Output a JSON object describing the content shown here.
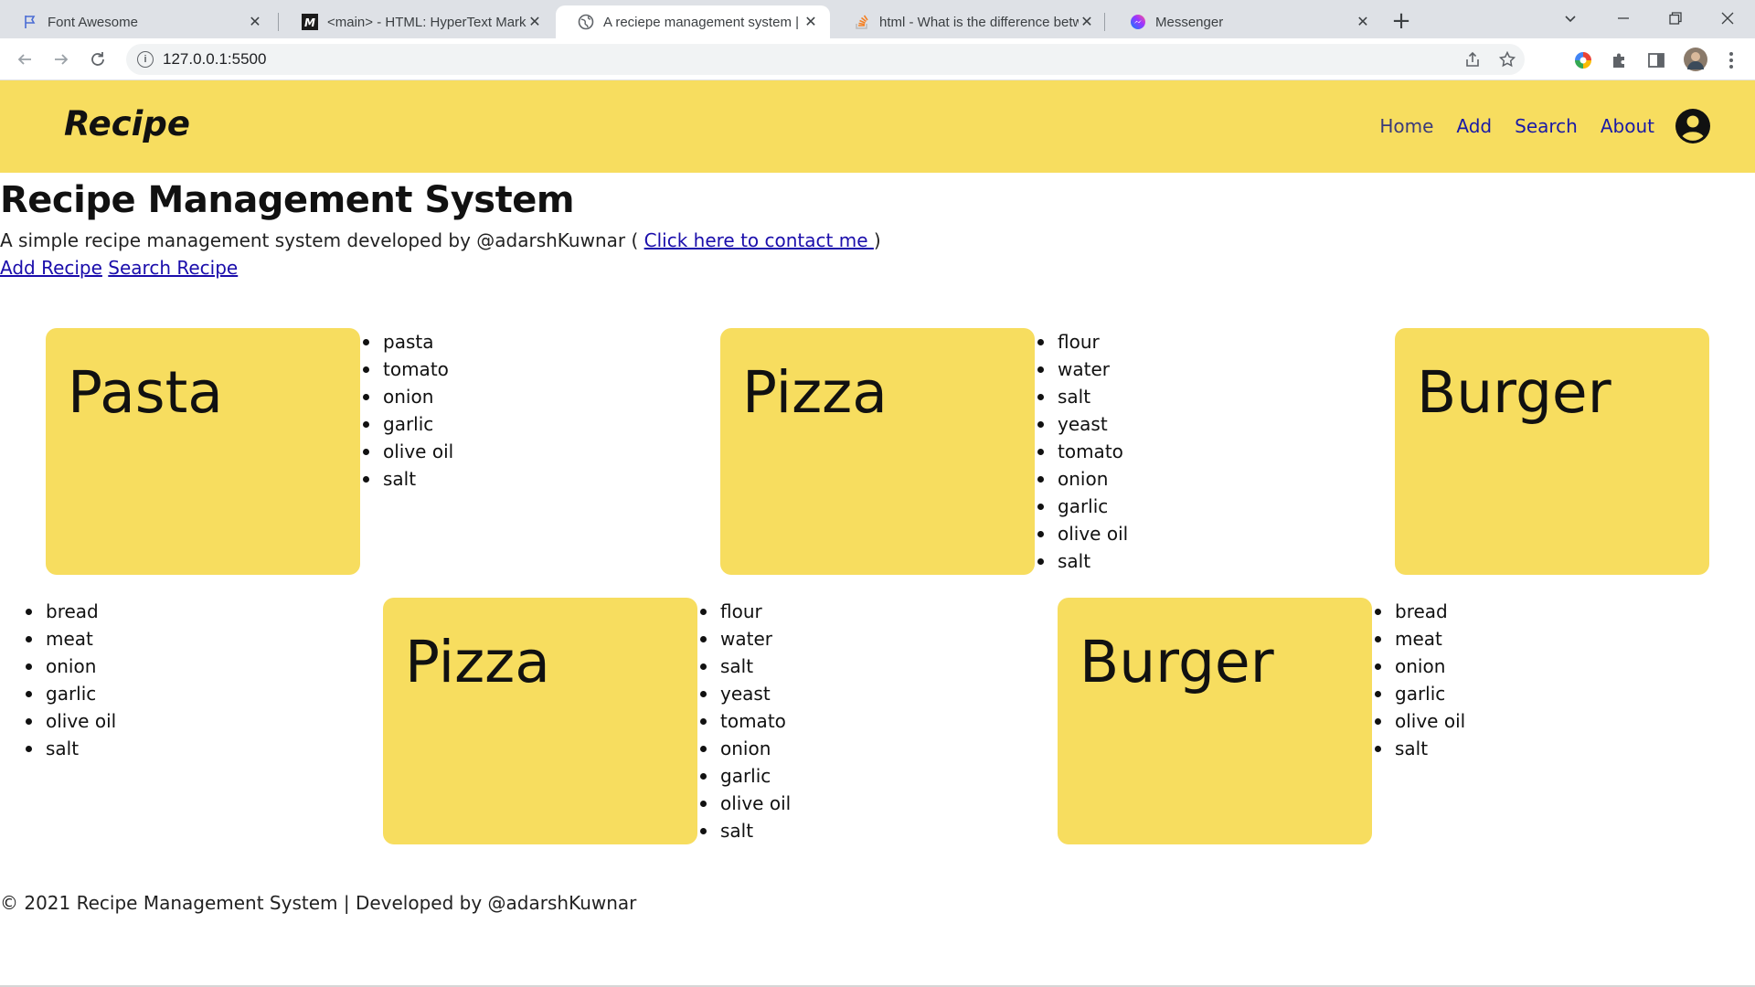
{
  "browser": {
    "tabs": [
      {
        "title": "Font Awesome",
        "icon": "flag-icon"
      },
      {
        "title": "<main> - HTML: HyperText Markup Language",
        "icon": "mdn-icon"
      },
      {
        "title": "A reciepe management system | Developed by",
        "icon": "globe-icon",
        "active": true
      },
      {
        "title": "html - What is the difference between",
        "icon": "stackoverflow-icon"
      },
      {
        "title": "Messenger",
        "icon": "messenger-icon"
      }
    ],
    "url": "127.0.0.1:5500"
  },
  "site": {
    "brand": "Recipe",
    "nav": [
      "Home",
      "Add",
      "Search",
      "About"
    ],
    "accent_color": "#f7dd5f"
  },
  "main": {
    "title": "Recipe Management System",
    "description_prefix": "A simple recipe management system developed by @adarshKuwnar ( ",
    "contact_link": "Click here to contact me ",
    "description_suffix": ")",
    "add_link": "Add Recipe",
    "search_link": "Search Recipe"
  },
  "recipes": [
    {
      "name": "Pasta",
      "ingredients": [
        "pasta",
        "tomato",
        "onion",
        "garlic",
        "olive oil",
        "salt"
      ]
    },
    {
      "name": "Pizza",
      "ingredients": [
        "flour",
        "water",
        "salt",
        "yeast",
        "tomato",
        "onion",
        "garlic",
        "olive oil",
        "salt"
      ]
    },
    {
      "name": "Burger",
      "ingredients": [
        "bread",
        "meat",
        "onion",
        "garlic",
        "olive oil",
        "salt"
      ]
    },
    {
      "name": "Pizza",
      "ingredients": [
        "flour",
        "water",
        "salt",
        "yeast",
        "tomato",
        "onion",
        "garlic",
        "olive oil",
        "salt"
      ]
    },
    {
      "name": "Burger",
      "ingredients": [
        "bread",
        "meat",
        "onion",
        "garlic",
        "olive oil",
        "salt"
      ]
    }
  ],
  "footer": "© 2021 Recipe Management System | Developed by @adarshKuwnar"
}
